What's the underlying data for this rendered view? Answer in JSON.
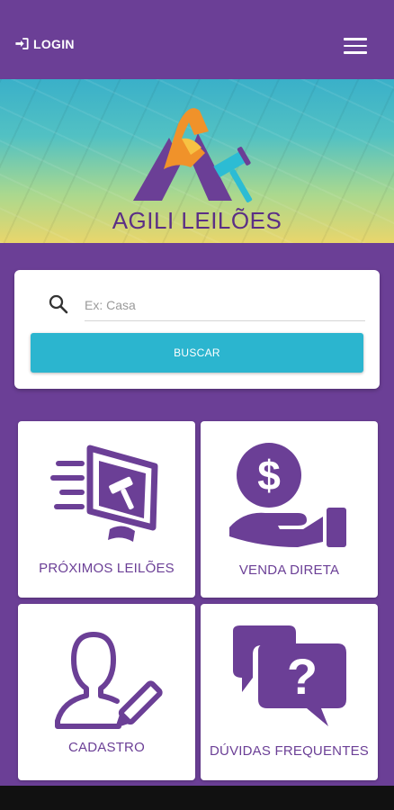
{
  "header": {
    "login_label": "LOGIN",
    "login_icon": "sign-in-icon",
    "menu_icon": "hamburger-menu-icon"
  },
  "hero": {
    "brand_name": "AGILI LEILÕES",
    "logo_icon": "gavel-triangle-logo"
  },
  "search": {
    "placeholder": "Ex: Casa",
    "value": "",
    "button_label": "BUSCAR"
  },
  "tiles": [
    {
      "label": "PRÓXIMOS LEILÕES",
      "icon": "online-auction-monitor-icon"
    },
    {
      "label": "VENDA DIRETA",
      "icon": "money-hand-icon"
    },
    {
      "label": "CADASTRO",
      "icon": "user-edit-icon"
    },
    {
      "label": "DÚVIDAS FREQUENTES",
      "icon": "question-chat-icon"
    }
  ],
  "colors": {
    "primary_purple": "#6b3f96",
    "accent_cyan": "#2bb5cf",
    "logo_orange": "#f0922a",
    "logo_cyan": "#2cbcd4"
  }
}
